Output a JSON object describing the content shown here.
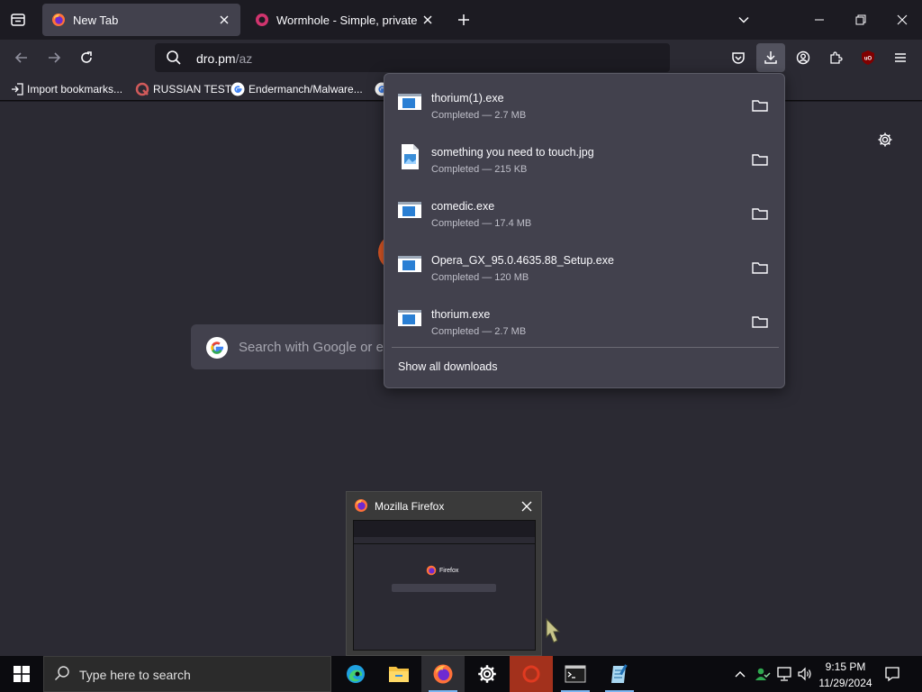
{
  "tabs": [
    {
      "title": "New Tab",
      "active": true
    },
    {
      "title": "Wormhole - Simple, private file"
    }
  ],
  "urlbar": {
    "host": "dro.pm",
    "path": "/az"
  },
  "bookmarks": [
    {
      "label": "Import bookmarks..."
    },
    {
      "label": "RUSSIAN TEST"
    },
    {
      "label": "Endermanch/Malware..."
    }
  ],
  "page": {
    "search_placeholder": "Search with Google or en"
  },
  "downloads": {
    "items": [
      {
        "name": "thorium(1).exe",
        "status": "Completed — 2.7 MB",
        "type": "exe"
      },
      {
        "name": "something you need to touch.jpg",
        "status": "Completed — 215 KB",
        "type": "image"
      },
      {
        "name": "comedic.exe",
        "status": "Completed — 17.4 MB",
        "type": "exe"
      },
      {
        "name": "Opera_GX_95.0.4635.88_Setup.exe",
        "status": "Completed — 120 MB",
        "type": "exe"
      },
      {
        "name": "thorium.exe",
        "status": "Completed — 2.7 MB",
        "type": "exe"
      }
    ],
    "show_all": "Show all downloads"
  },
  "preview": {
    "title": "Mozilla Firefox",
    "thumb_brand": "Firefox"
  },
  "taskbar": {
    "search_placeholder": "Type here to search",
    "time": "9:15 PM",
    "date": "11/29/2024"
  },
  "colors": {
    "accent": "#7cb6f2",
    "panel": "#42414d",
    "toolbar": "#2b2a33",
    "ublock": "#800000"
  }
}
